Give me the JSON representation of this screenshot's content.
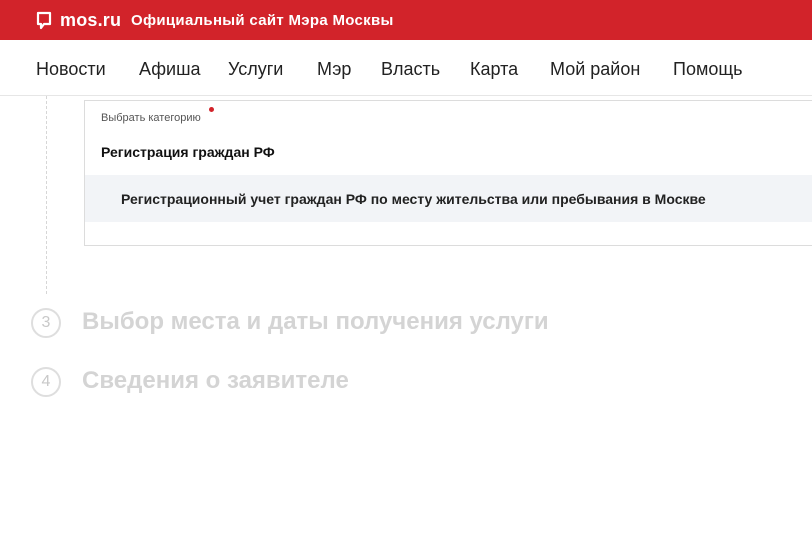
{
  "header": {
    "logo_text": "mos.ru",
    "site_title": "Официальный сайт Мэра Москвы",
    "bg_color": "#d2232a"
  },
  "nav": {
    "items": [
      {
        "label": "Новости"
      },
      {
        "label": "Афиша"
      },
      {
        "label": "Услуги"
      },
      {
        "label": "Мэр"
      },
      {
        "label": "Власть"
      },
      {
        "label": "Карта"
      },
      {
        "label": "Мой район"
      },
      {
        "label": "Помощь"
      }
    ]
  },
  "category_select": {
    "label": "Выбрать категорию",
    "selected": "Регистрация граждан РФ",
    "options": [
      {
        "label": "Регистрационный учет граждан РФ по месту жительства или пребывания в Москве"
      }
    ]
  },
  "steps": [
    {
      "number": "3",
      "title": "Выбор места и даты получения услуги"
    },
    {
      "number": "4",
      "title": "Сведения о заявителе"
    }
  ]
}
